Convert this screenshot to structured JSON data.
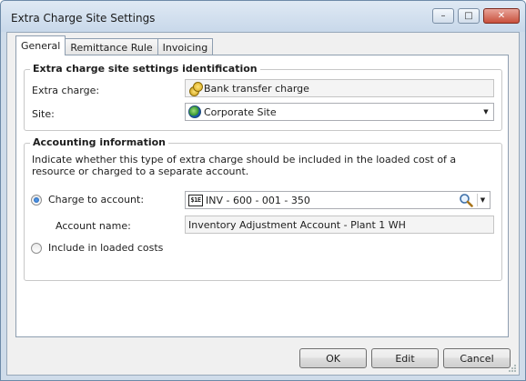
{
  "window": {
    "title": "Extra Charge Site Settings",
    "controls": {
      "minimize": "–",
      "maximize": "□",
      "close": "✕"
    }
  },
  "tabs": [
    {
      "label": "General",
      "active": true
    },
    {
      "label": "Remittance Rule",
      "active": false
    },
    {
      "label": "Invoicing",
      "active": false
    }
  ],
  "identification": {
    "title": "Extra charge site settings identification",
    "extra_charge_label": "Extra charge:",
    "extra_charge_value": "Bank transfer charge",
    "extra_charge_icon": "coins-icon",
    "site_label": "Site:",
    "site_value": "Corporate Site",
    "site_icon": "globe-icon"
  },
  "accounting": {
    "title": "Accounting information",
    "description": "Indicate whether this type of extra charge should be included in the loaded cost of a resource or charged to a separate account.",
    "charge_option_label": "Charge to account:",
    "charge_selected": true,
    "account_icon_text": "$1E",
    "account_value": "INV - 600 - 001 - 350",
    "account_name_label": "Account name:",
    "account_name_value": "Inventory Adjustment Account - Plant 1 WH",
    "loaded_costs_label": "Include in loaded costs",
    "loaded_costs_selected": false
  },
  "buttons": {
    "ok": "OK",
    "edit": "Edit",
    "cancel": "Cancel"
  },
  "colors": {
    "frame": "#cfdcea",
    "close_button": "#c9503c",
    "radio_accent": "#1c5aa8"
  }
}
